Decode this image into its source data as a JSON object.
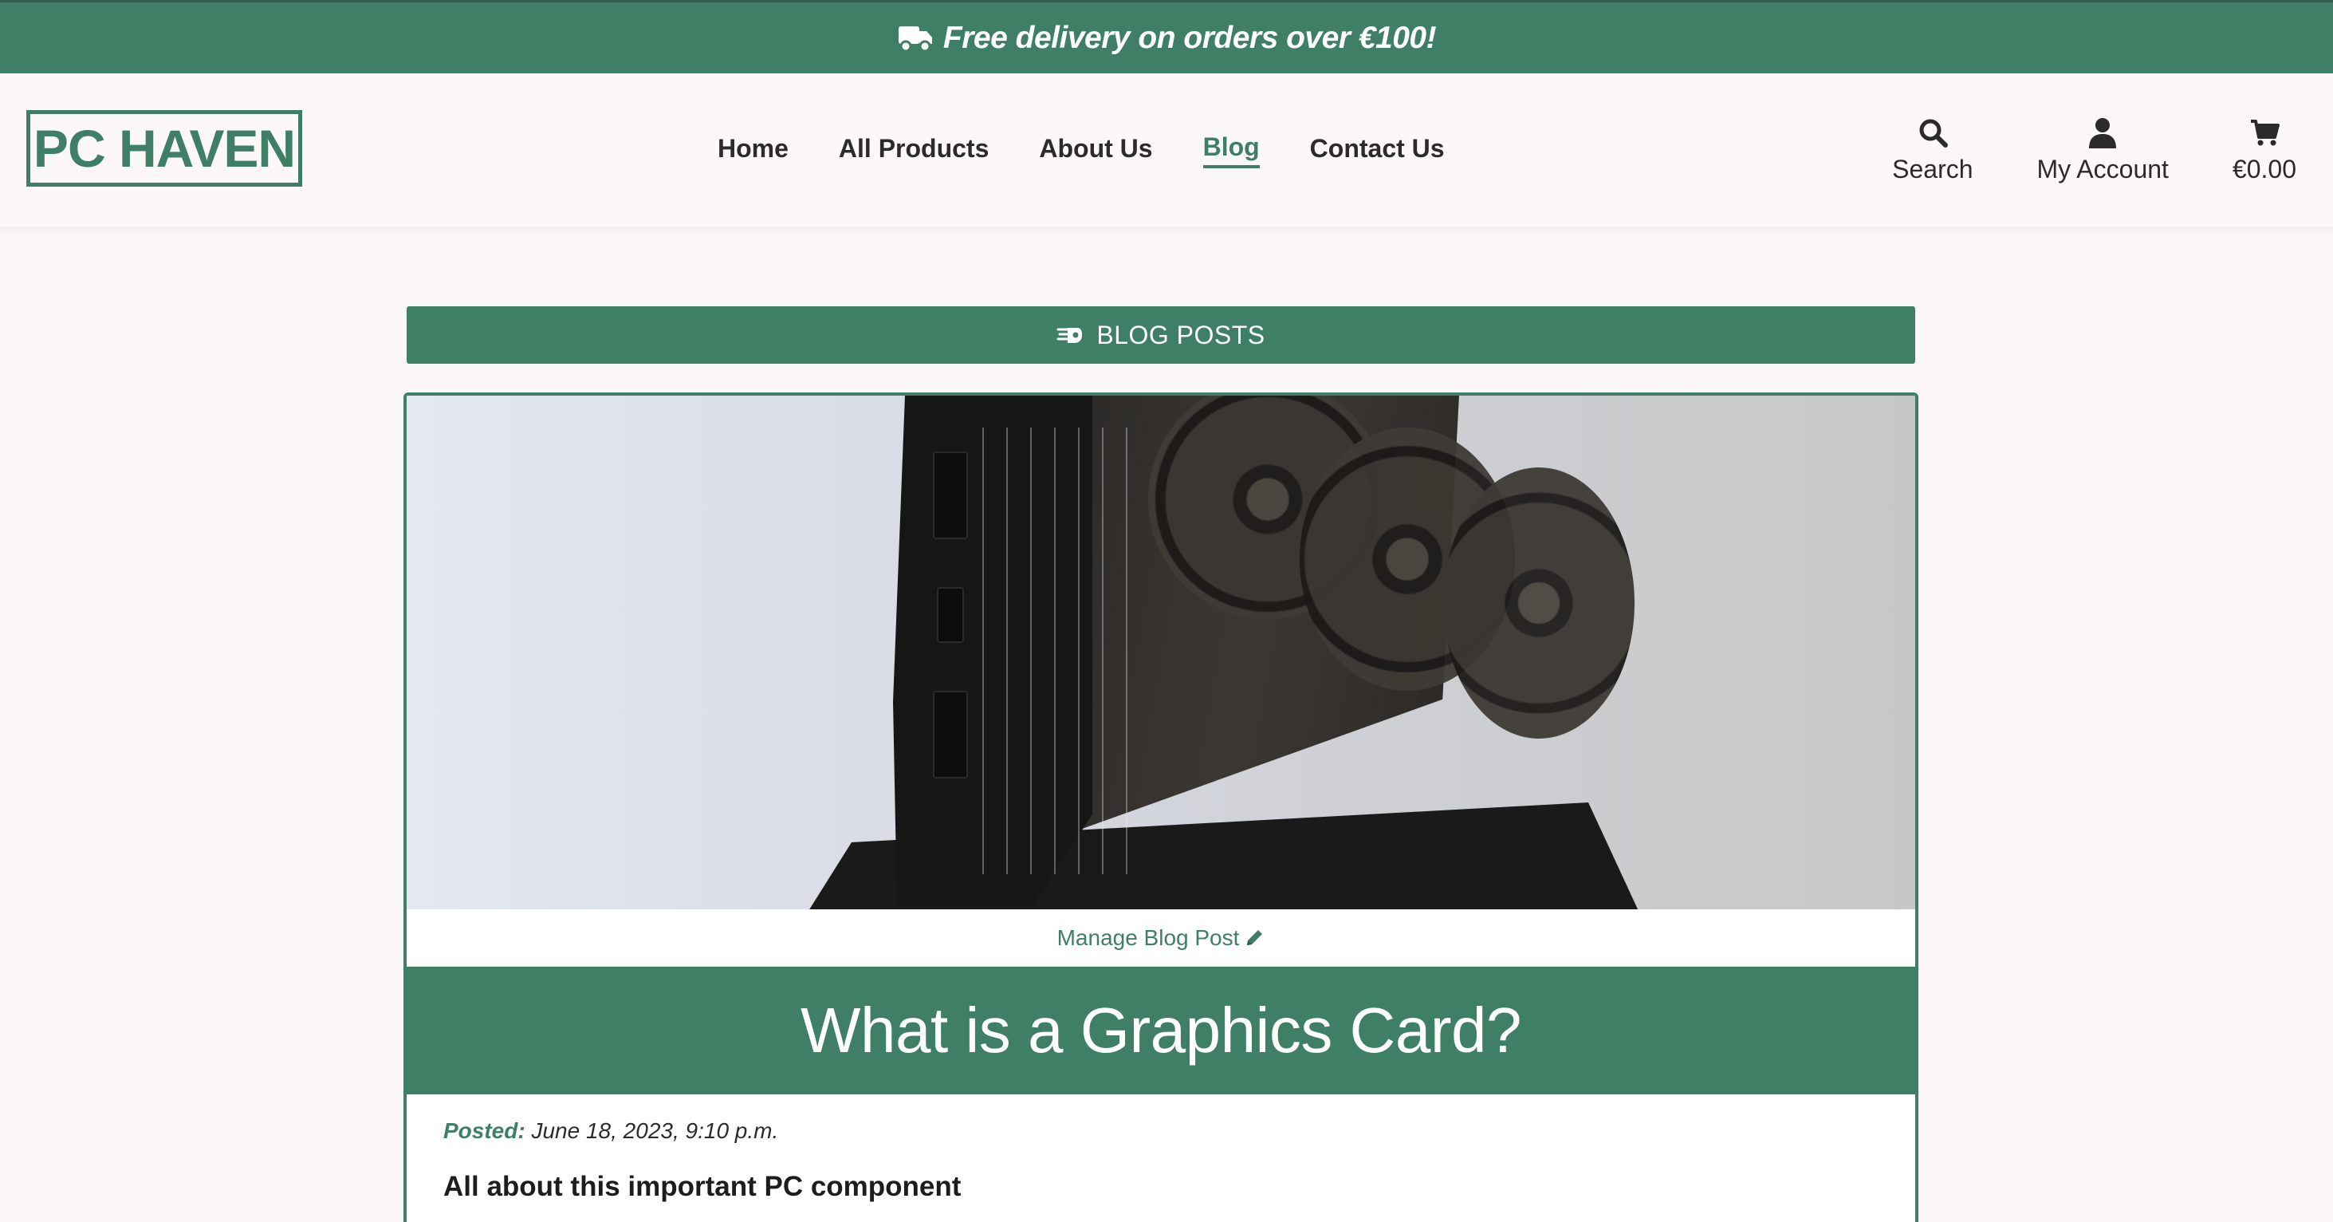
{
  "banner": {
    "icon": "truck-icon",
    "text": "Free delivery on orders over €100!"
  },
  "header": {
    "logo": "PC HAVEN",
    "nav": [
      {
        "label": "Home",
        "active": false
      },
      {
        "label": "All Products",
        "active": false
      },
      {
        "label": "About Us",
        "active": false
      },
      {
        "label": "Blog",
        "active": true
      },
      {
        "label": "Contact Us",
        "active": false
      }
    ],
    "tools": {
      "search_label": "Search",
      "account_label": "My Account",
      "bag_total": "€0.00"
    }
  },
  "section": {
    "icon": "hand-pointing-icon",
    "title": "BLOG POSTS"
  },
  "post": {
    "manage_label": "Manage Blog Post",
    "title": "What is a Graphics Card?",
    "posted_label": "Posted:",
    "posted_date": "June 18, 2023, 9:10 p.m.",
    "subtitle": "All about this important PC component"
  },
  "colors": {
    "brand_green": "#3e7f65",
    "page_background": "#fcf7f7",
    "text_dark": "#2b2b2b"
  }
}
